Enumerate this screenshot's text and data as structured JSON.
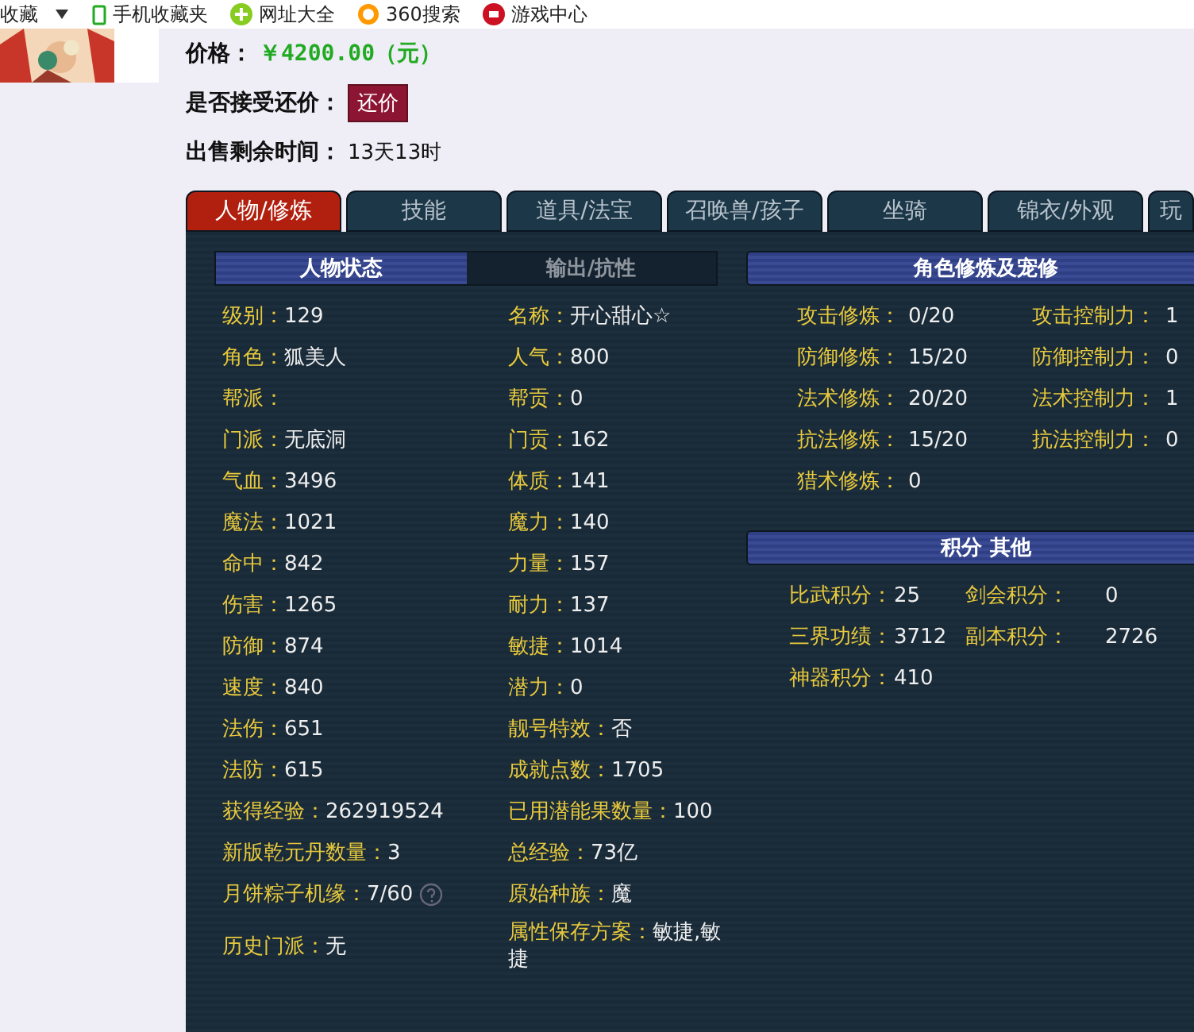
{
  "bookmarks": [
    {
      "label": "收藏",
      "kind": "dropdown"
    },
    {
      "label": "手机收藏夹",
      "kind": "phone"
    },
    {
      "label": "网址大全",
      "kind": "plus"
    },
    {
      "label": "360搜索",
      "kind": "ring"
    },
    {
      "label": "游戏中心",
      "kind": "game"
    }
  ],
  "listing": {
    "price_label": "价格：",
    "price": "￥4200.00（元）",
    "bargain_label": "是否接受还价：",
    "bargain_button": "还价",
    "time_label": "出售剩余时间：",
    "time": "13天13时"
  },
  "tabs": [
    {
      "label": "人物/修炼",
      "selected": true
    },
    {
      "label": "技能",
      "selected": false
    },
    {
      "label": "道具/法宝",
      "selected": false
    },
    {
      "label": "召唤兽/孩子",
      "selected": false
    },
    {
      "label": "坐骑",
      "selected": false
    },
    {
      "label": "锦衣/外观",
      "selected": false
    },
    {
      "label": "玩",
      "selected": false
    }
  ],
  "subtabs": [
    {
      "label": "人物状态",
      "selected": true
    },
    {
      "label": "输出/抗性",
      "selected": false
    }
  ],
  "stats": [
    {
      "left": {
        "label": "级别：",
        "value": "129"
      },
      "right": {
        "label": "名称：",
        "value": "开心甜心☆"
      }
    },
    {
      "left": {
        "label": "角色：",
        "value": "狐美人"
      },
      "right": {
        "label": "人气：",
        "value": "800"
      }
    },
    {
      "left": {
        "label": "帮派："
      },
      "right": {
        "label": "帮贡：",
        "value": "0"
      }
    },
    {
      "left": {
        "label": "门派：",
        "value": "无底洞"
      },
      "right": {
        "label": "门贡：",
        "value": "162"
      }
    },
    {
      "left": {
        "label": "气血：",
        "value": "3496"
      },
      "right": {
        "label": "体质：",
        "value": "141"
      }
    },
    {
      "left": {
        "label": "魔法：",
        "value": "1021"
      },
      "right": {
        "label": "魔力：",
        "value": "140"
      }
    },
    {
      "left": {
        "label": "命中：",
        "value": "842"
      },
      "right": {
        "label": "力量：",
        "value": "157"
      }
    },
    {
      "left": {
        "label": "伤害：",
        "value": "1265"
      },
      "right": {
        "label": "耐力：",
        "value": "137"
      }
    },
    {
      "left": {
        "label": "防御：",
        "value": "874"
      },
      "right": {
        "label": "敏捷：",
        "value": "1014"
      }
    },
    {
      "left": {
        "label": "速度：",
        "value": "840"
      },
      "right": {
        "label": "潜力：",
        "value": "0"
      }
    },
    {
      "left": {
        "label": "法伤：",
        "value": "651"
      },
      "right": {
        "label": "靓号特效：",
        "value": "否"
      }
    },
    {
      "left": {
        "label": "法防：",
        "value": "615"
      },
      "right": {
        "label": "成就点数：",
        "value": "1705"
      }
    },
    {
      "left": {
        "label": "获得经验：",
        "value": "262919524"
      },
      "right": {
        "label": "已用潜能果数量：",
        "value": "100"
      }
    },
    {
      "left": {
        "label": "新版乾元丹数量：",
        "value": "3"
      },
      "right": {
        "label": "总经验：",
        "value": "73亿"
      }
    },
    {
      "left": {
        "label": "月饼粽子机缘：",
        "value": "7/60",
        "help": true
      },
      "right": {
        "label": "原始种族：",
        "value": "魔"
      }
    },
    {
      "left": {
        "label": "历史门派：",
        "value": "无"
      },
      "right": {
        "label": "属性保存方案：",
        "value": "敏捷,敏捷"
      }
    }
  ],
  "cultivation": {
    "title": "角色修炼及宠修",
    "rows": [
      {
        "label": "攻击修炼：",
        "value": "0/20",
        "label_2": "攻击控制力：",
        "value_2": "1"
      },
      {
        "label": "防御修炼：",
        "value": "15/20",
        "label_2": "防御控制力：",
        "value_2": "0"
      },
      {
        "label": "法术修炼：",
        "value": "20/20",
        "label_2": "法术控制力：",
        "value_2": "1"
      },
      {
        "label": "抗法修炼：",
        "value": "15/20",
        "label_2": "抗法控制力：",
        "value_2": "0"
      },
      {
        "label": "猎术修炼：",
        "value": "0"
      }
    ]
  },
  "points": {
    "title": "积分 其他",
    "rows": [
      {
        "label": "比武积分：",
        "value": "25",
        "label_2": "剑会积分：",
        "value_2": "0"
      },
      {
        "label": "三界功绩：",
        "value": "3712",
        "label_2": "副本积分：",
        "value_2": "2726"
      },
      {
        "label": "神器积分：",
        "value": "410"
      }
    ]
  }
}
